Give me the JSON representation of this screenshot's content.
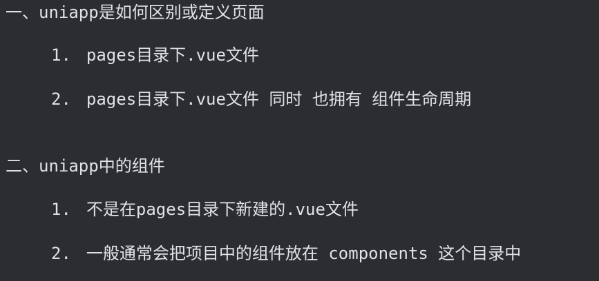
{
  "sections": [
    {
      "heading": "一、uniapp是如何区别或定义页面",
      "items": [
        {
          "number": "1.",
          "text": "pages目录下.vue文件"
        },
        {
          "number": "2.",
          "text": "pages目录下.vue文件 同时 也拥有 组件生命周期"
        }
      ]
    },
    {
      "heading": "二、uniapp中的组件",
      "items": [
        {
          "number": "1.",
          "text": "不是在pages目录下新建的.vue文件"
        },
        {
          "number": "2.",
          "text": "一般通常会把项目中的组件放在 components 这个目录中"
        }
      ]
    }
  ]
}
